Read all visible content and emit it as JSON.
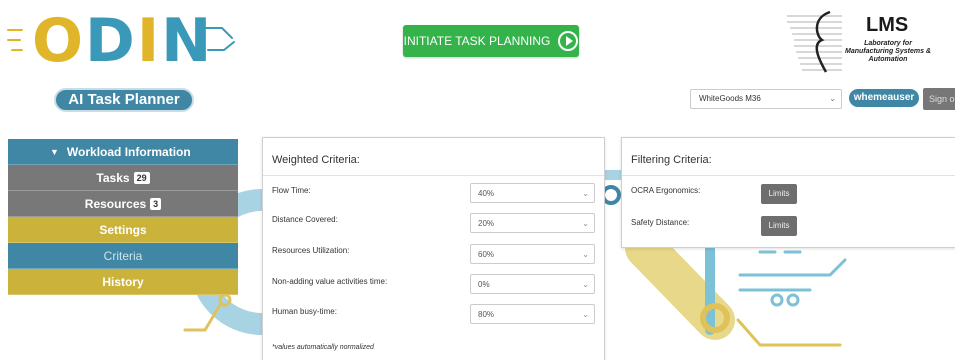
{
  "logo": {
    "word": [
      "O",
      "D",
      "I",
      "N"
    ],
    "product": "AI Task Planner"
  },
  "header": {
    "initiate_label": "INITIATE TASK PLANNING",
    "workspace": {
      "selected": "WhiteGoods M36"
    },
    "user": "whemeauser",
    "signout_label": "Sign o"
  },
  "lms": {
    "title": "LMS",
    "subtitle": "Laboratory for Manufacturing Systems & Automation"
  },
  "sidebar": {
    "header": "Workload Information",
    "items": [
      {
        "label": "Tasks",
        "count": "29"
      },
      {
        "label": "Resources",
        "count": "3"
      },
      {
        "label": "Settings"
      },
      {
        "label": "Criteria"
      },
      {
        "label": "History"
      }
    ]
  },
  "weighted": {
    "title": "Weighted Criteria:",
    "rows": [
      {
        "label": "Flow Time:",
        "value": "40%"
      },
      {
        "label": "Distance Covered:",
        "value": "20%"
      },
      {
        "label": "Resources Utilization:",
        "value": "60%"
      },
      {
        "label": "Non-adding value activities time:",
        "value": "0%"
      },
      {
        "label": "Human busy-time:",
        "value": "80%"
      }
    ],
    "note": "*values automatically normalized"
  },
  "filtering": {
    "title": "Filtering Criteria:",
    "rows": [
      {
        "label": "OCRA Ergonomics:",
        "button": "Limits"
      },
      {
        "label": "Safety Distance:",
        "button": "Limits"
      }
    ]
  },
  "colors": {
    "teal": "#3f87a5",
    "gold": "#cbb23a",
    "gray": "#787878",
    "green": "#33b34a"
  }
}
